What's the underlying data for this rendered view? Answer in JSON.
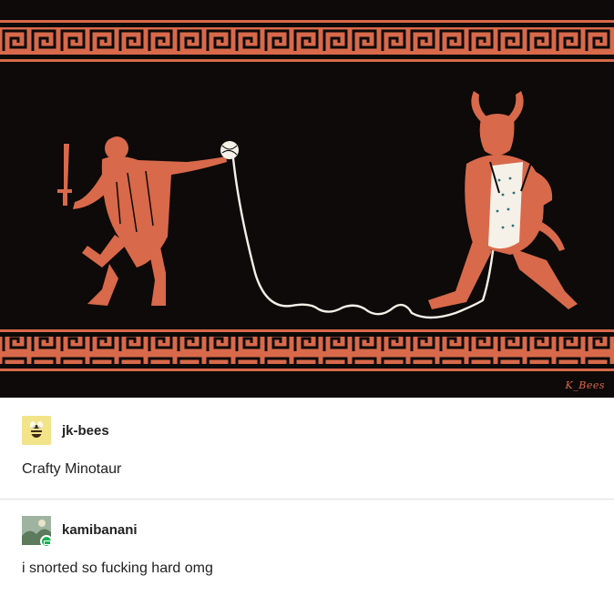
{
  "artwork": {
    "signature": "K_Bees",
    "colors": {
      "background": "#0d0a09",
      "terracotta": "#d8694a",
      "thread": "#f5f1e8"
    }
  },
  "posts": [
    {
      "username": "jk-bees",
      "text": "Crafty Minotaur",
      "avatar_icon": "bee-icon"
    },
    {
      "username": "kamibanani",
      "text": "i snorted so fucking hard omg",
      "avatar_icon": "landscape-avatar",
      "badge_icon": "chat-badge-icon"
    }
  ]
}
